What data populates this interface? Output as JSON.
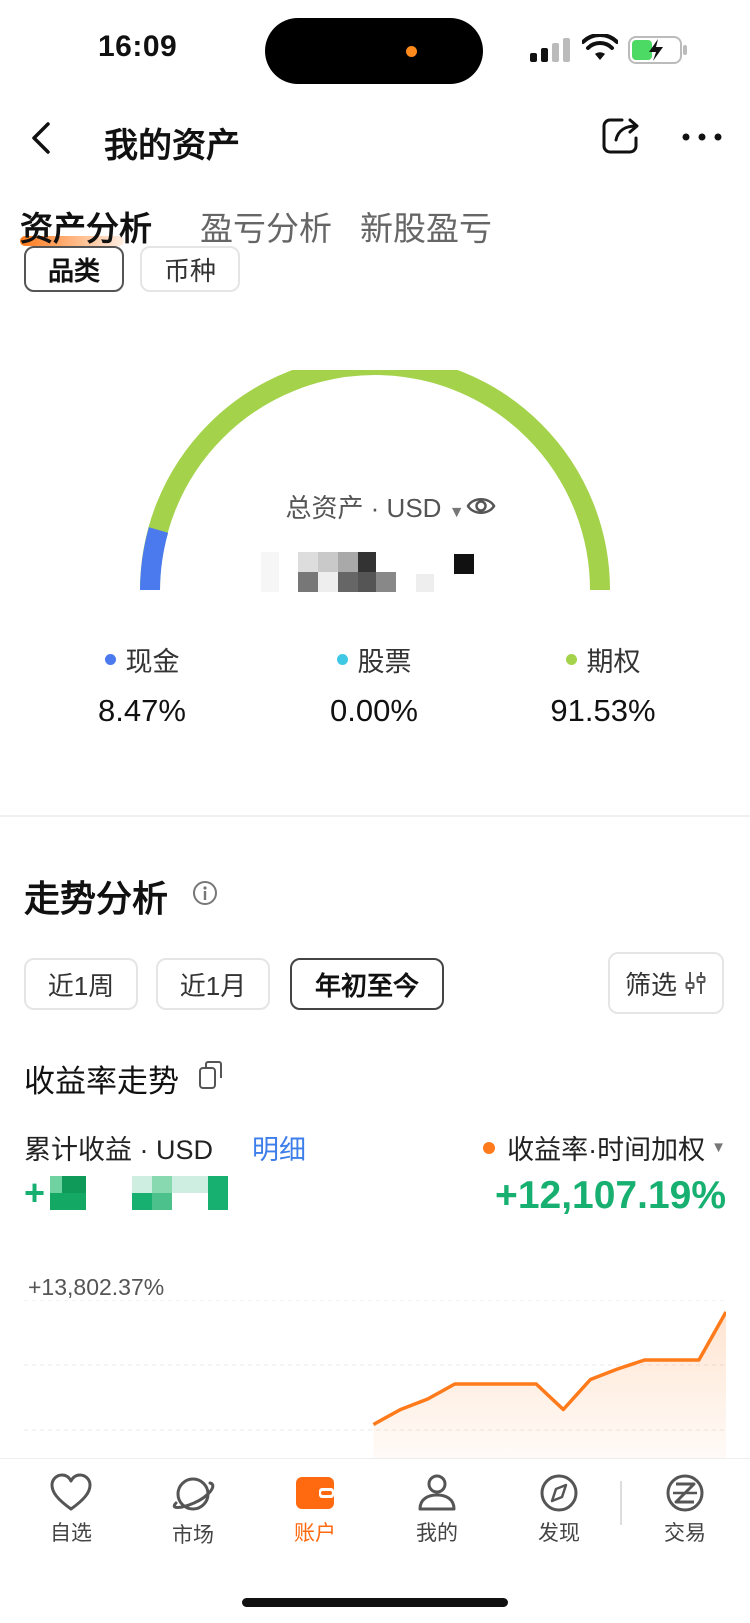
{
  "status": {
    "time": "16:09"
  },
  "nav": {
    "title": "我的资产"
  },
  "tabs": [
    "资产分析",
    "盈亏分析",
    "新股盈亏"
  ],
  "segments": [
    "品类",
    "币种"
  ],
  "overview": {
    "total_label": "总资产 · USD",
    "allocation": [
      {
        "name": "现金",
        "pct": "8.47%",
        "color": "#4b79ee"
      },
      {
        "name": "股票",
        "pct": "0.00%",
        "color": "#3fc8e4"
      },
      {
        "name": "期权",
        "pct": "91.53%",
        "color": "#a4d24a"
      }
    ]
  },
  "trend": {
    "title": "走势分析",
    "ranges": [
      "近1周",
      "近1月",
      "年初至今"
    ],
    "filter": "筛选",
    "chart_title": "收益率走势",
    "cum_label": "累计收益 · USD",
    "detail": "明细",
    "metric": "收益率·时间加权",
    "metric_value": "+12,107.19%",
    "cum_sign": "+"
  },
  "chart_data": {
    "type": "area",
    "y_max_label": "+13,802.37%",
    "series": [
      {
        "values": [
          null,
          null,
          null,
          null,
          null,
          null,
          null,
          null,
          null,
          null,
          null,
          null,
          0.25,
          0.35,
          0.42,
          0.52,
          0.52,
          0.52,
          0.52,
          0.35,
          0.55,
          0.62,
          0.68,
          0.68,
          0.68,
          1.0
        ]
      }
    ],
    "color": "#ff7a1a"
  },
  "tabbar": [
    {
      "label": "自选",
      "icon": "heart-icon"
    },
    {
      "label": "市场",
      "icon": "planet-icon"
    },
    {
      "label": "账户",
      "icon": "wallet-icon"
    },
    {
      "label": "我的",
      "icon": "person-icon"
    },
    {
      "label": "发现",
      "icon": "compass-icon"
    },
    {
      "label": "交易",
      "icon": "trade-icon"
    }
  ]
}
